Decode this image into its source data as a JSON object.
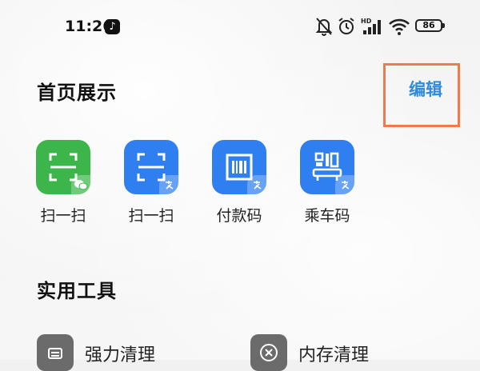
{
  "status_bar": {
    "time": "11:26",
    "battery": "86",
    "icons": [
      "tiktok-icon",
      "mute-bell-icon",
      "alarm-icon",
      "hd-signal-icon",
      "wifi-icon",
      "battery-icon"
    ]
  },
  "home_display": {
    "title": "首页展示",
    "edit_label": "编辑",
    "apps": [
      {
        "label": "扫一扫",
        "icon": "wechat-scan-icon",
        "color": "#3cb64a",
        "badge": "wechat-badge-icon"
      },
      {
        "label": "扫一扫",
        "icon": "alipay-scan-icon",
        "color": "#2f7ff0",
        "badge": "alipay-badge-icon"
      },
      {
        "label": "付款码",
        "icon": "payment-code-icon",
        "color": "#2f7ff0",
        "badge": "alipay-badge-icon"
      },
      {
        "label": "乘车码",
        "icon": "transit-code-icon",
        "color": "#2f7ff0",
        "badge": "alipay-badge-icon"
      }
    ]
  },
  "tools": {
    "title": "实用工具",
    "items": [
      {
        "label": "强力清理",
        "icon": "cleaner-icon"
      },
      {
        "label": "内存清理",
        "icon": "memory-clean-icon"
      }
    ]
  },
  "colors": {
    "accent": "#2f8bde",
    "highlight": "#f07a4e",
    "wechat_green": "#3cb64a",
    "alipay_blue": "#2f7ff0"
  }
}
